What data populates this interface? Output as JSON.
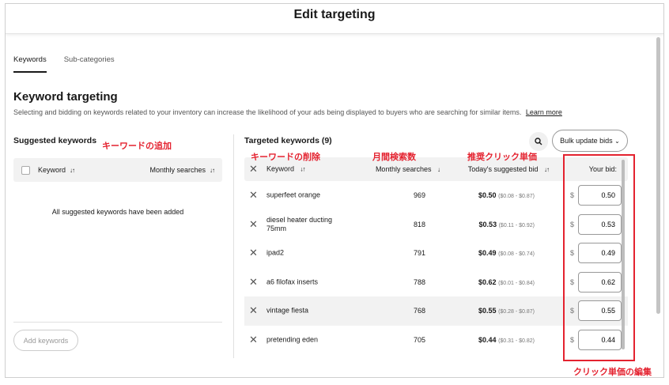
{
  "modal": {
    "title": "Edit targeting"
  },
  "tabs": [
    {
      "label": "Keywords",
      "active": true
    },
    {
      "label": "Sub-categories",
      "active": false
    }
  ],
  "section": {
    "title": "Keyword targeting",
    "description": "Selecting and bidding on keywords related to your inventory can increase the likelihood of your ads being displayed to buyers who are searching for similar items.",
    "learn_more": "Learn more"
  },
  "suggested": {
    "title": "Suggested keywords",
    "col_keyword": "Keyword",
    "col_monthly": "Monthly searches",
    "empty_message": "All suggested keywords have been added",
    "add_button": "Add keywords"
  },
  "targeted": {
    "title": "Targeted keywords (9)",
    "bulk_button": "Bulk update bids",
    "columns": {
      "keyword": "Keyword",
      "monthly": "Monthly searches",
      "suggested": "Today's suggested bid",
      "your_bid": "Your bid:"
    },
    "currency": "$",
    "rows": [
      {
        "keyword": "superfeet orange",
        "monthly": "969",
        "bid": "$0.50",
        "range": "($0.08 - $0.87)",
        "your_bid": "0.50"
      },
      {
        "keyword": "diesel heater ducting 75mm",
        "monthly": "818",
        "bid": "$0.53",
        "range": "($0.11 - $0.92)",
        "your_bid": "0.53"
      },
      {
        "keyword": "ipad2",
        "monthly": "791",
        "bid": "$0.49",
        "range": "($0.08 - $0.74)",
        "your_bid": "0.49"
      },
      {
        "keyword": "a6 filofax inserts",
        "monthly": "788",
        "bid": "$0.62",
        "range": "($0.01 - $0.84)",
        "your_bid": "0.62"
      },
      {
        "keyword": "vintage fiesta",
        "monthly": "768",
        "bid": "$0.55",
        "range": "($0.28 - $0.87)",
        "your_bid": "0.55"
      },
      {
        "keyword": "pretending eden",
        "monthly": "705",
        "bid": "$0.44",
        "range": "($0.31 - $0.82)",
        "your_bid": "0.44"
      }
    ]
  },
  "annotations": {
    "add_keyword": "キーワードの追加",
    "delete_keyword": "キーワードの削除",
    "monthly_searches": "月間検索数",
    "recommended_cpc": "推奨クリック単価",
    "edit_cpc": "クリック単価の編集"
  },
  "colors": {
    "annotation": "#e4222f",
    "header_bg": "#f2f2f2"
  }
}
